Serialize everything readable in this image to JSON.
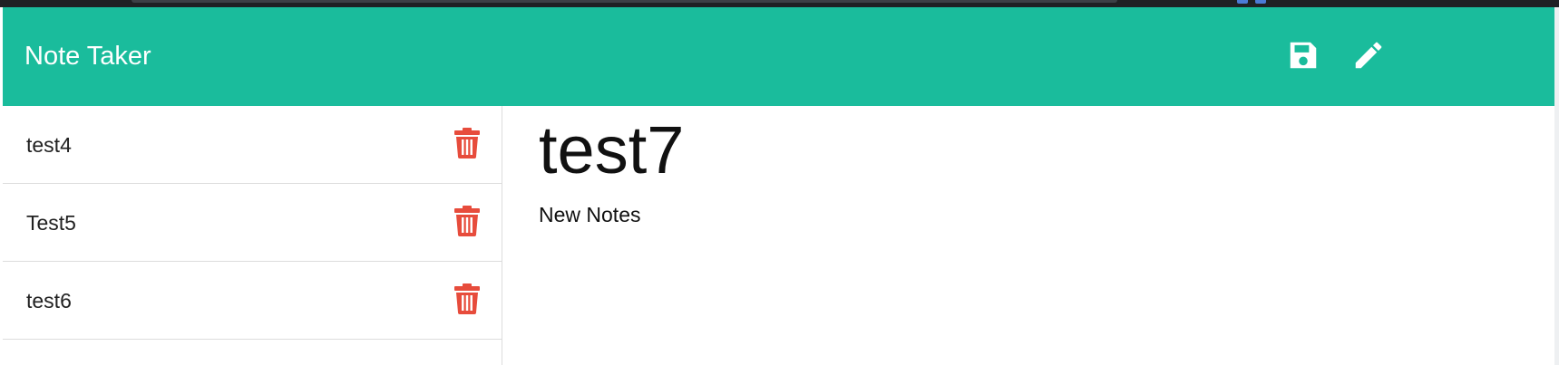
{
  "app": {
    "brand": "Note Taker"
  },
  "header": {
    "icons": [
      {
        "name": "save-icon"
      },
      {
        "name": "pencil-icon"
      }
    ]
  },
  "sidebar": {
    "notes": [
      {
        "title": "test4"
      },
      {
        "title": "Test5"
      },
      {
        "title": "test6"
      }
    ]
  },
  "editor": {
    "title": "test7",
    "text": "New Notes"
  },
  "colors": {
    "navbar": "#1abc9c",
    "trash": "#e74c3c"
  }
}
